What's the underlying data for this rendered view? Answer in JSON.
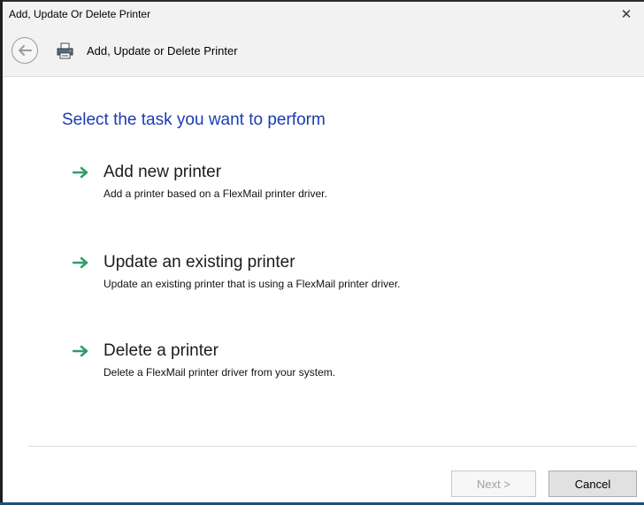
{
  "window": {
    "title": "Add, Update Or Delete Printer",
    "close_symbol": "✕"
  },
  "navbar": {
    "back_icon": "back-arrow-icon",
    "app_icon": "printer-icon",
    "title": "Add,  Update or Delete Printer"
  },
  "main": {
    "heading": "Select the task you want to perform",
    "tasks": [
      {
        "label": "Add new printer",
        "description": "Add a printer based on a FlexMail printer driver.",
        "icon": "green-arrow-icon"
      },
      {
        "label": "Update an existing printer",
        "description": "Update an existing printer that is using a FlexMail printer driver.",
        "icon": "green-arrow-icon"
      },
      {
        "label": "Delete a printer",
        "description": "Delete a FlexMail printer driver from your system.",
        "icon": "green-arrow-icon"
      }
    ]
  },
  "footer": {
    "next_label": "Next >",
    "next_enabled": false,
    "cancel_label": "Cancel"
  },
  "colors": {
    "heading": "#1a3cb4",
    "arrow": "#2e9e6a",
    "chrome": "#f2f2f2"
  }
}
